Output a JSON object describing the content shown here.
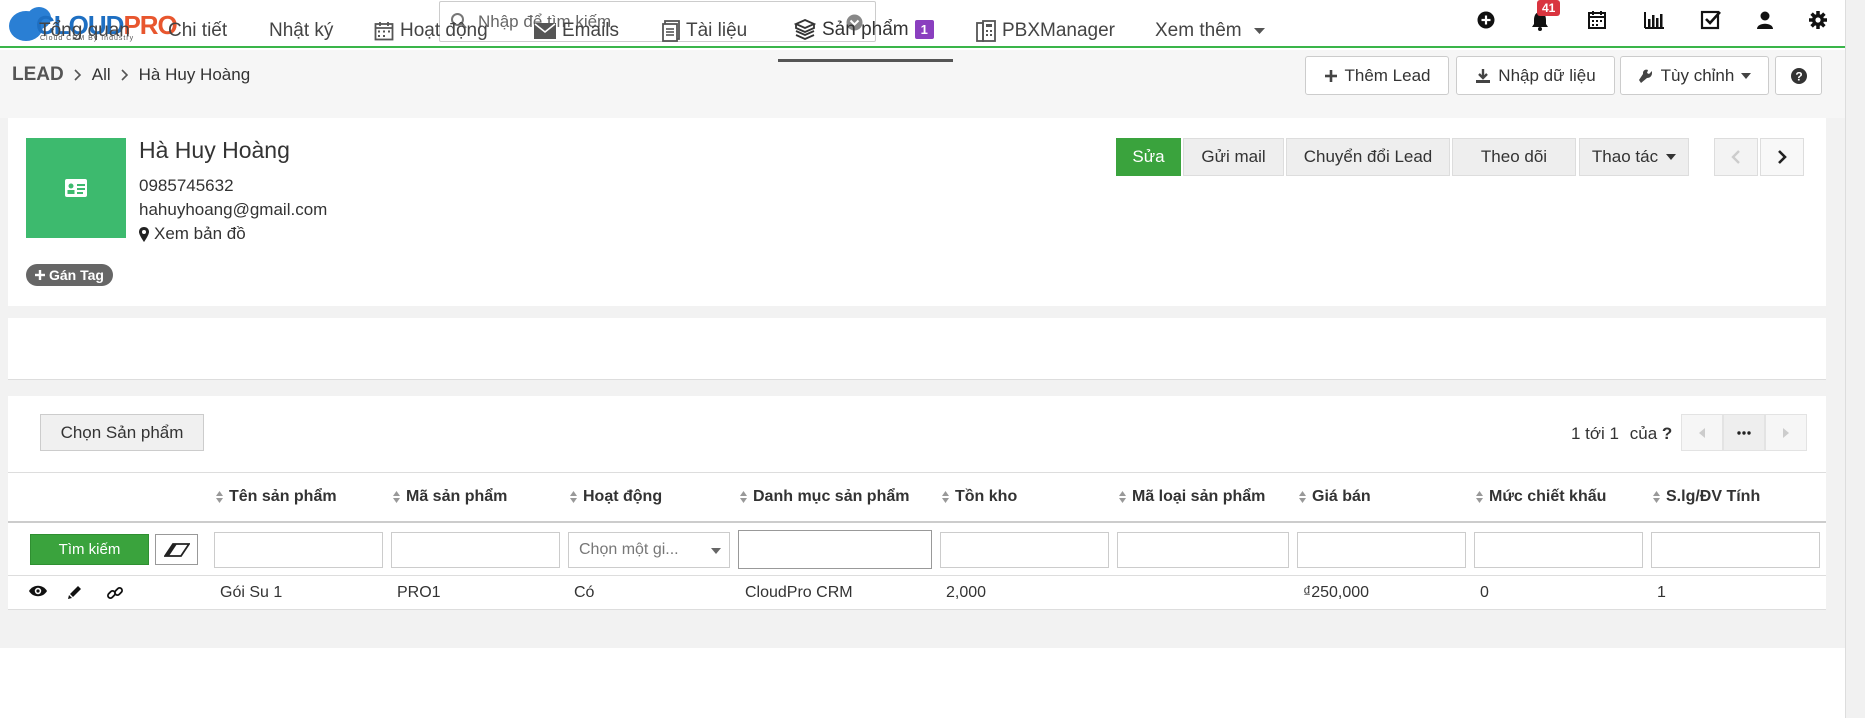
{
  "header": {
    "logo_cloud": "CLOUD",
    "logo_pro": "PRO",
    "logo_sub": "Cloud CRM By Industry",
    "search_placeholder": "Nhập để tìm kiếm",
    "notification_count": "41"
  },
  "breadcrumb": {
    "module": "LEAD",
    "filter": "All",
    "record": "Hà Huy Hoàng"
  },
  "toolbar": {
    "add_lead": "Thêm Lead",
    "import": "Nhập dữ liệu",
    "customize": "Tùy chỉnh",
    "help": "?"
  },
  "lead": {
    "name": "Hà Huy Hoàng",
    "phone": "0985745632",
    "email": "hahuyhoang@gmail.com",
    "map_link": "Xem bản đồ",
    "tag_button": "Gán Tag"
  },
  "actions": {
    "edit": "Sửa",
    "send_mail": "Gửi mail",
    "convert": "Chuyển đổi Lead",
    "follow": "Theo dõi",
    "more": "Thao tác"
  },
  "tabs": [
    {
      "label": "Tổng quan"
    },
    {
      "label": "Chi tiết"
    },
    {
      "label": "Nhật ký"
    },
    {
      "label": "Hoạt động"
    },
    {
      "label": "Emails"
    },
    {
      "label": "Tài liệu"
    },
    {
      "label": "Sản phẩm",
      "badge": "1"
    },
    {
      "label": "PBXManager"
    },
    {
      "label": "Xem thêm"
    }
  ],
  "products": {
    "choose_button": "Chọn Sản phẩm",
    "pager": {
      "range": "1 tới 1",
      "of_label": "của",
      "total": "?"
    },
    "columns": [
      "Tên sản phẩm",
      "Mã sản phẩm",
      "Hoạt động",
      "Danh mục sản phẩm",
      "Tồn kho",
      "Mã loại sản phẩm",
      "Giá bán",
      "Mức chiết khấu",
      "S.lg/ĐV Tính"
    ],
    "search_button": "Tìm kiếm",
    "select_placeholder": "Chọn một gi...",
    "rows": [
      {
        "name": "Gói Su 1",
        "code": "PRO1",
        "active": "Có",
        "category": "CloudPro CRM",
        "stock": "2,000",
        "type_code": "",
        "price": "₫250,000",
        "discount": "0",
        "qty_unit": "1"
      }
    ]
  },
  "colors": {
    "accent_green": "#3aa33d",
    "avatar_green": "#3dba6e",
    "badge_purple": "#8a3fbf",
    "badge_red": "#d9343f"
  }
}
